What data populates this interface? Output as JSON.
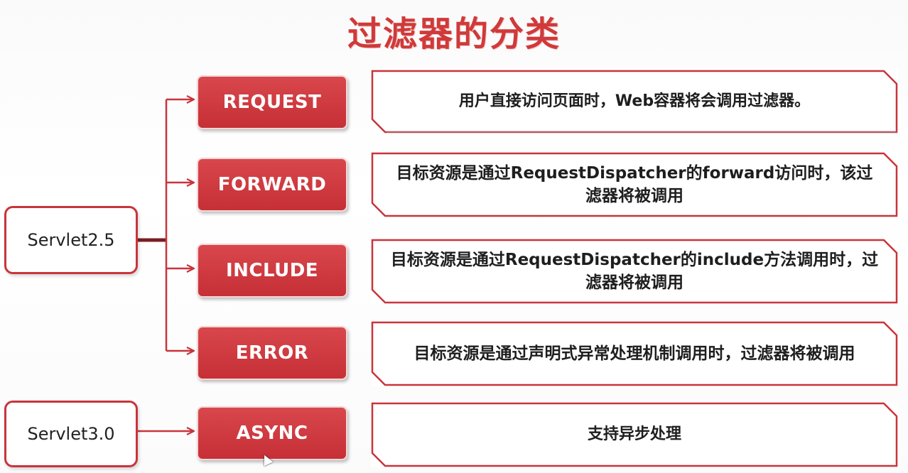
{
  "title": "过滤器的分类",
  "servlets": [
    {
      "label": "Servlet2.5"
    },
    {
      "label": "Servlet3.0"
    }
  ],
  "types": [
    {
      "label": "REQUEST",
      "desc": "用户直接访问页面时，Web容器将会调用过滤器。"
    },
    {
      "label": "FORWARD",
      "desc": "目标资源是通过RequestDispatcher的forward访问时，该过滤器将被调用"
    },
    {
      "label": "INCLUDE",
      "desc": "目标资源是通过RequestDispatcher的include方法调用时，过滤器将被调用"
    },
    {
      "label": "ERROR",
      "desc": "目标资源是通过声明式异常处理机制调用时，过滤器将被调用"
    },
    {
      "label": "ASYNC",
      "desc": "支持异步处理"
    }
  ],
  "colors": {
    "accent": "#c9343b",
    "title": "#d03a3a",
    "connector": "#c9343b"
  }
}
